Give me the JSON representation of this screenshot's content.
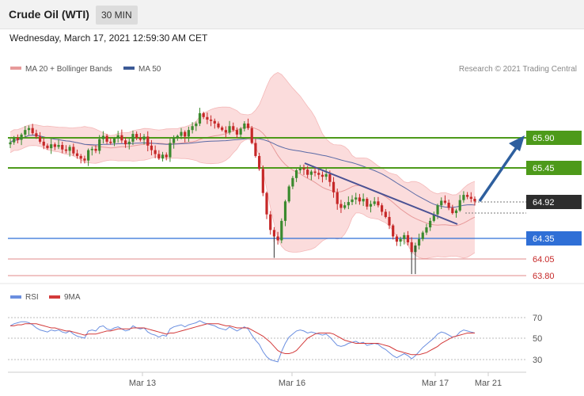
{
  "header": {
    "title": "Crude Oil (WTI)",
    "timeframe": "30 MIN"
  },
  "timestamp": "Wednesday, March 17, 2021 12:59:30 AM CET",
  "legend": {
    "ma20_bb": "MA 20 + Bollinger Bands",
    "ma50": "MA 50"
  },
  "copyright": "Research © 2021 Trading Central",
  "colors": {
    "up": "#3b8a2e",
    "down": "#c62828",
    "ma20": "#e79a9a",
    "ma50": "#5a6aa6",
    "bb_fill": "#fbdcdc",
    "green_line": "#4d9a1a",
    "blue_line": "#2f6fd6",
    "red_line": "#e08a8a",
    "arrow": "#2e5f9e",
    "trend": "#4a5294",
    "rsi": "#6b8fe0",
    "ma9": "#d33a3a",
    "current_tag": "#2d2d2d"
  },
  "chart_data": [
    {
      "type": "candlestick",
      "title": "Crude Oil (WTI)",
      "timeframe": "30 MIN",
      "ylim": [
        63.7,
        66.4
      ],
      "x_labels": [
        "Mar 13",
        "Mar 16",
        "Mar 17",
        "Mar 21"
      ],
      "series": [
        {
          "name": "MA 20 + Bollinger Bands",
          "kind": "band_with_line"
        },
        {
          "name": "MA 50",
          "kind": "line"
        }
      ],
      "key_levels": [
        {
          "value": "65.90",
          "kind": "resistance",
          "color": "#4d9a1a"
        },
        {
          "value": "65.45",
          "kind": "resistance",
          "color": "#4d9a1a"
        },
        {
          "value": "64.92",
          "kind": "current",
          "color": "#2d2d2d"
        },
        {
          "value": "64.35",
          "kind": "pivot",
          "color": "#2f6fd6"
        },
        {
          "value": "64.05",
          "kind": "support",
          "color": "#e08a8a"
        },
        {
          "value": "63.80",
          "kind": "support",
          "color": "#e08a8a"
        }
      ],
      "closes": [
        65.83,
        65.9,
        65.87,
        65.95,
        66.02,
        66.05,
        65.97,
        65.92,
        65.84,
        65.78,
        65.74,
        65.8,
        65.76,
        65.79,
        65.72,
        65.7,
        65.76,
        65.66,
        65.62,
        65.58,
        65.55,
        65.71,
        65.73,
        65.7,
        65.88,
        65.93,
        65.84,
        65.82,
        65.89,
        65.94,
        65.86,
        65.8,
        65.84,
        65.96,
        65.9,
        65.87,
        65.92,
        65.78,
        65.71,
        65.65,
        65.58,
        65.64,
        65.6,
        65.82,
        65.9,
        65.93,
        65.99,
        65.92,
        66.02,
        66.08,
        66.12,
        66.28,
        66.22,
        66.18,
        66.16,
        66.12,
        66.06,
        66.02,
        65.98,
        66.08,
        66.02,
        65.95,
        66.04,
        66.12,
        66.05,
        65.82,
        65.62,
        65.42,
        65.05,
        64.72,
        64.48,
        64.38,
        64.32,
        64.62,
        64.92,
        65.15,
        65.28,
        65.4,
        65.43,
        65.41,
        65.33,
        65.38,
        65.36,
        65.33,
        65.3,
        65.34,
        65.22,
        65.06,
        64.88,
        64.82,
        64.86,
        64.91,
        64.95,
        64.98,
        64.92,
        64.96,
        64.84,
        64.88,
        64.92,
        64.86,
        64.76,
        64.68,
        64.55,
        64.38,
        64.3,
        64.34,
        64.4,
        64.29,
        64.14,
        64.24,
        64.34,
        64.44,
        64.52,
        64.62,
        64.72,
        64.86,
        64.93,
        64.9,
        64.82,
        64.74,
        64.78,
        64.94,
        65.02,
        64.99,
        64.96,
        64.92
      ]
    },
    {
      "type": "line",
      "series": [
        {
          "name": "RSI"
        },
        {
          "name": "9MA"
        }
      ],
      "ylim": [
        20,
        80
      ],
      "y_ticks": [
        "70",
        "50",
        "30"
      ],
      "rsi": [
        62,
        64,
        65,
        66,
        66,
        65,
        63,
        60,
        58,
        57,
        56,
        58,
        57,
        58,
        56,
        55,
        57,
        54,
        52,
        51,
        50,
        57,
        58,
        57,
        61,
        62,
        59,
        58,
        60,
        61,
        59,
        57,
        58,
        62,
        60,
        59,
        60,
        56,
        54,
        53,
        51,
        53,
        52,
        59,
        61,
        62,
        63,
        61,
        63,
        64,
        65,
        67,
        65,
        64,
        63,
        62,
        60,
        59,
        58,
        61,
        59,
        57,
        59,
        61,
        59,
        53,
        48,
        44,
        37,
        32,
        29,
        28,
        27,
        37,
        45,
        51,
        54,
        57,
        58,
        57,
        55,
        56,
        55,
        54,
        53,
        54,
        51,
        47,
        43,
        42,
        43,
        45,
        46,
        47,
        45,
        46,
        43,
        44,
        45,
        44,
        41,
        39,
        36,
        33,
        31,
        33,
        35,
        33,
        30,
        33,
        37,
        41,
        44,
        47,
        50,
        54,
        56,
        55,
        53,
        51,
        52,
        56,
        58,
        57,
        56,
        55
      ],
      "ma9": [
        62,
        62,
        63,
        63,
        64,
        64,
        64,
        64,
        63,
        62,
        61,
        60,
        60,
        59,
        58,
        57,
        57,
        56,
        55,
        54,
        53,
        54,
        54,
        54,
        55,
        56,
        57,
        57,
        58,
        59,
        59,
        59,
        59,
        60,
        60,
        60,
        60,
        59,
        58,
        57,
        56,
        55,
        54,
        55,
        55,
        56,
        57,
        58,
        59,
        60,
        61,
        62,
        63,
        64,
        64,
        64,
        64,
        63,
        62,
        62,
        61,
        60,
        60,
        60,
        60,
        58,
        56,
        54,
        52,
        49,
        46,
        42,
        38,
        36,
        35,
        35,
        36,
        38,
        42,
        46,
        50,
        52,
        54,
        55,
        55,
        55,
        55,
        54,
        52,
        50,
        48,
        47,
        46,
        45,
        45,
        45,
        45,
        45,
        45,
        45,
        44,
        43,
        42,
        40,
        38,
        37,
        36,
        35,
        34,
        34,
        34,
        35,
        36,
        38,
        40,
        42,
        45,
        47,
        49,
        51,
        52,
        53,
        54,
        55,
        55,
        55
      ]
    }
  ]
}
